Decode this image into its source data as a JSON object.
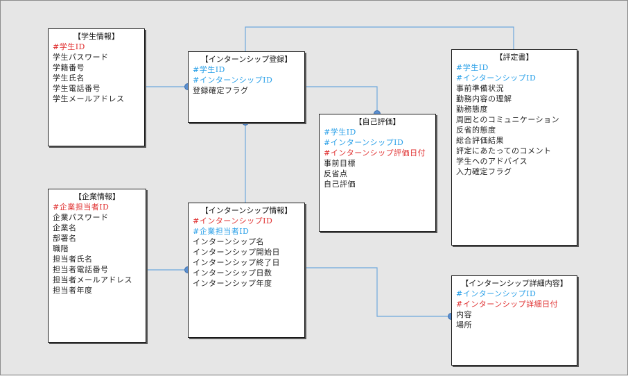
{
  "colors": {
    "primary_key": "#e03030",
    "foreign_key": "#2aa0e8",
    "plain": "#222222",
    "connector_line": "#6ea8dc",
    "connector_dot": "#5b8fd0"
  },
  "entities": {
    "student": {
      "title": "【学生情報】",
      "fields": [
        {
          "text": "#学生ID",
          "kind": "pk"
        },
        {
          "text": "学生パスワード",
          "kind": "plain"
        },
        {
          "text": "学籍番号",
          "kind": "plain"
        },
        {
          "text": "学生氏名",
          "kind": "plain"
        },
        {
          "text": "学生電話番号",
          "kind": "plain"
        },
        {
          "text": "学生メールアドレス",
          "kind": "plain"
        }
      ]
    },
    "registration": {
      "title": "【インターンシップ登録】",
      "fields": [
        {
          "text": "#学生ID",
          "kind": "fk"
        },
        {
          "text": "#インターンシップID",
          "kind": "fk"
        },
        {
          "text": "登録確定フラグ",
          "kind": "plain"
        }
      ]
    },
    "self_eval": {
      "title": "【自己評価】",
      "fields": [
        {
          "text": "#学生ID",
          "kind": "fk"
        },
        {
          "text": "#インターンシップID",
          "kind": "fk"
        },
        {
          "text": "#インターンシップ評価日付",
          "kind": "pk"
        },
        {
          "text": "事前目標",
          "kind": "plain"
        },
        {
          "text": "反省点",
          "kind": "plain"
        },
        {
          "text": "自己評価",
          "kind": "plain"
        }
      ]
    },
    "evaluation": {
      "title": "【評定書】",
      "fields": [
        {
          "text": "#学生ID",
          "kind": "fk"
        },
        {
          "text": "#インターンシップID",
          "kind": "fk"
        },
        {
          "text": "事前準備状況",
          "kind": "plain"
        },
        {
          "text": "勤務内容の理解",
          "kind": "plain"
        },
        {
          "text": "勤務態度",
          "kind": "plain"
        },
        {
          "text": "周囲とのコミュニケーション",
          "kind": "plain"
        },
        {
          "text": "反省的態度",
          "kind": "plain"
        },
        {
          "text": "総合評価結果",
          "kind": "plain"
        },
        {
          "text": "評定にあたってのコメント",
          "kind": "plain"
        },
        {
          "text": "学生へのアドバイス",
          "kind": "plain"
        },
        {
          "text": "入力確定フラグ",
          "kind": "plain"
        }
      ]
    },
    "company": {
      "title": "【企業情報】",
      "fields": [
        {
          "text": "#企業担当者ID",
          "kind": "pk"
        },
        {
          "text": "企業パスワード",
          "kind": "plain"
        },
        {
          "text": "企業名",
          "kind": "plain"
        },
        {
          "text": "部署名",
          "kind": "plain"
        },
        {
          "text": "職階",
          "kind": "plain"
        },
        {
          "text": "担当者氏名",
          "kind": "plain"
        },
        {
          "text": "担当者電話番号",
          "kind": "plain"
        },
        {
          "text": "担当者メールアドレス",
          "kind": "plain"
        },
        {
          "text": "担当者年度",
          "kind": "plain"
        }
      ]
    },
    "internship": {
      "title": "【インターンシップ情報】",
      "fields": [
        {
          "text": "#インターンシップID",
          "kind": "pk"
        },
        {
          "text": "#企業担当者ID",
          "kind": "fk"
        },
        {
          "text": "インターンシップ名",
          "kind": "plain"
        },
        {
          "text": "インターンシップ開始日",
          "kind": "plain"
        },
        {
          "text": "インターンシップ終了日",
          "kind": "plain"
        },
        {
          "text": "インターンシップ日数",
          "kind": "plain"
        },
        {
          "text": "インターンシップ年度",
          "kind": "plain"
        }
      ]
    },
    "detail": {
      "title": "【インターンシップ詳細内容】",
      "fields": [
        {
          "text": "#インターンシップID",
          "kind": "fk"
        },
        {
          "text": "#インターンシップ詳細日付",
          "kind": "pk"
        },
        {
          "text": "内容",
          "kind": "plain"
        },
        {
          "text": "場所",
          "kind": "plain"
        }
      ]
    }
  }
}
